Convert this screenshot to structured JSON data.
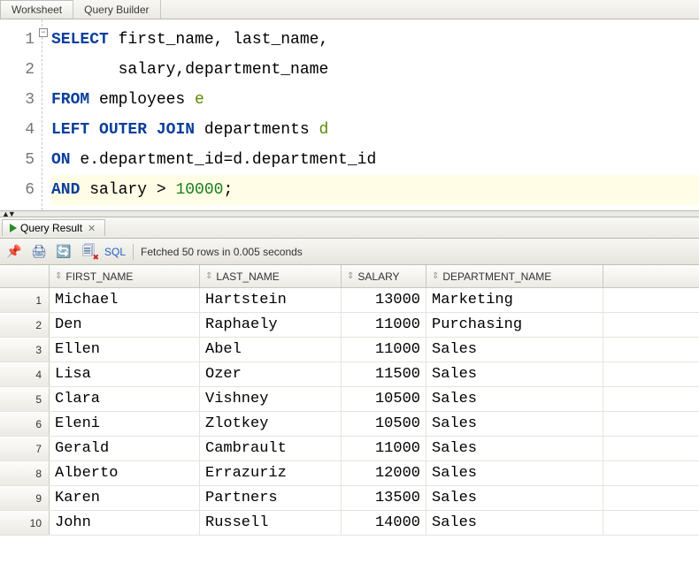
{
  "tabs": {
    "worksheet": "Worksheet",
    "query_builder": "Query Builder"
  },
  "editor": {
    "line_numbers": [
      "1",
      "2",
      "3",
      "4",
      "5",
      "6"
    ],
    "l1": {
      "select": "SELECT",
      "rest": " first_name, last_name,"
    },
    "l2": {
      "rest": "       salary,department_name"
    },
    "l3": {
      "from": "FROM",
      "rest1": " employees ",
      "alias": "e"
    },
    "l4": {
      "left": "LEFT",
      "outer": "OUTER",
      "join": "JOIN",
      "rest1": " departments ",
      "alias": "d"
    },
    "l5": {
      "on": "ON",
      "rest": " e.department_id=d.department_id"
    },
    "l6": {
      "and": "AND",
      "rest1": " salary > ",
      "num": "10000",
      "semi": ";"
    }
  },
  "result_tab": {
    "label": "Query Result"
  },
  "toolbar": {
    "sql_label": "SQL",
    "status": "Fetched 50 rows in 0.005 seconds"
  },
  "columns": {
    "first_name": "FIRST_NAME",
    "last_name": "LAST_NAME",
    "salary": "SALARY",
    "department_name": "DEPARTMENT_NAME"
  },
  "rows": [
    {
      "n": "1",
      "first": "Michael",
      "last": "Hartstein",
      "sal": "13000",
      "dept": "Marketing"
    },
    {
      "n": "2",
      "first": "Den",
      "last": "Raphaely",
      "sal": "11000",
      "dept": "Purchasing"
    },
    {
      "n": "3",
      "first": "Ellen",
      "last": "Abel",
      "sal": "11000",
      "dept": "Sales"
    },
    {
      "n": "4",
      "first": "Lisa",
      "last": "Ozer",
      "sal": "11500",
      "dept": "Sales"
    },
    {
      "n": "5",
      "first": "Clara",
      "last": "Vishney",
      "sal": "10500",
      "dept": "Sales"
    },
    {
      "n": "6",
      "first": "Eleni",
      "last": "Zlotkey",
      "sal": "10500",
      "dept": "Sales"
    },
    {
      "n": "7",
      "first": "Gerald",
      "last": "Cambrault",
      "sal": "11000",
      "dept": "Sales"
    },
    {
      "n": "8",
      "first": "Alberto",
      "last": "Errazuriz",
      "sal": "12000",
      "dept": "Sales"
    },
    {
      "n": "9",
      "first": "Karen",
      "last": "Partners",
      "sal": "13500",
      "dept": "Sales"
    },
    {
      "n": "10",
      "first": "John",
      "last": "Russell",
      "sal": "14000",
      "dept": "Sales"
    }
  ]
}
